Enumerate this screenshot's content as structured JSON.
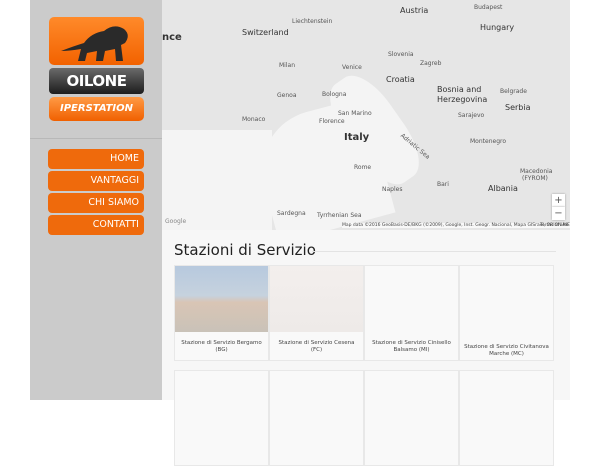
{
  "brand": {
    "name": "OILONE",
    "sub": "IPERSTATION"
  },
  "nav": [
    {
      "label": "HOME"
    },
    {
      "label": "VANTAGGI"
    },
    {
      "label": "CHI SIAMO"
    },
    {
      "label": "CONTATTI"
    }
  ],
  "map": {
    "labels": {
      "austria": "Austria",
      "hungary": "Hungary",
      "switzerland": "Switzerland",
      "liechtenstein": "Liechtenstein",
      "slovenia": "Slovenia",
      "croatia": "Croatia",
      "bosnia": "Bosnia and",
      "herzegovina": "Herzegovina",
      "serbia": "Serbia",
      "italy": "Italy",
      "montenegro": "Montenegro",
      "albania": "Albania",
      "macedonia": "Macedonia",
      "fyrom": "(FYROM)",
      "budapest": "Budapest",
      "zagreb": "Zagreb",
      "venice": "Venice",
      "milan": "Milan",
      "genoa": "Genoa",
      "bologna": "Bologna",
      "florence": "Florence",
      "monaco": "Monaco",
      "rome": "Rome",
      "naples": "Naples",
      "bari": "Bari",
      "sarajevo": "Sarajevo",
      "belgrade": "Belgrade",
      "sanmarino": "San Marino",
      "france": "nce",
      "sardegna": "Sardegna",
      "tyrrhenian": "Tyrrhenian Sea",
      "adriatic": "Adriatic Sea"
    },
    "zoom_in": "+",
    "zoom_out": "−",
    "attribution": "Map data ©2016 GeoBasis-DE/BKG (©2009), Google, Inst. Geogr. Nacional, Mapa GISrael, ORION-ME",
    "terms": "Terms of Use",
    "google": "Google"
  },
  "section": {
    "title": "Stazioni di Servizio"
  },
  "stations": [
    {
      "name": "Stazione di Servizio Bergamo (BG)"
    },
    {
      "name": "Stazione di Servizio Cesena (FC)"
    },
    {
      "name": "Stazione di Servizio Cinisello Balsamo (MI)"
    },
    {
      "name": "Stazione di Servizio Civitanova Marche (MC)"
    }
  ],
  "colors": {
    "accent": "#ef6a0c",
    "sidebar": "#cbcbcb"
  }
}
